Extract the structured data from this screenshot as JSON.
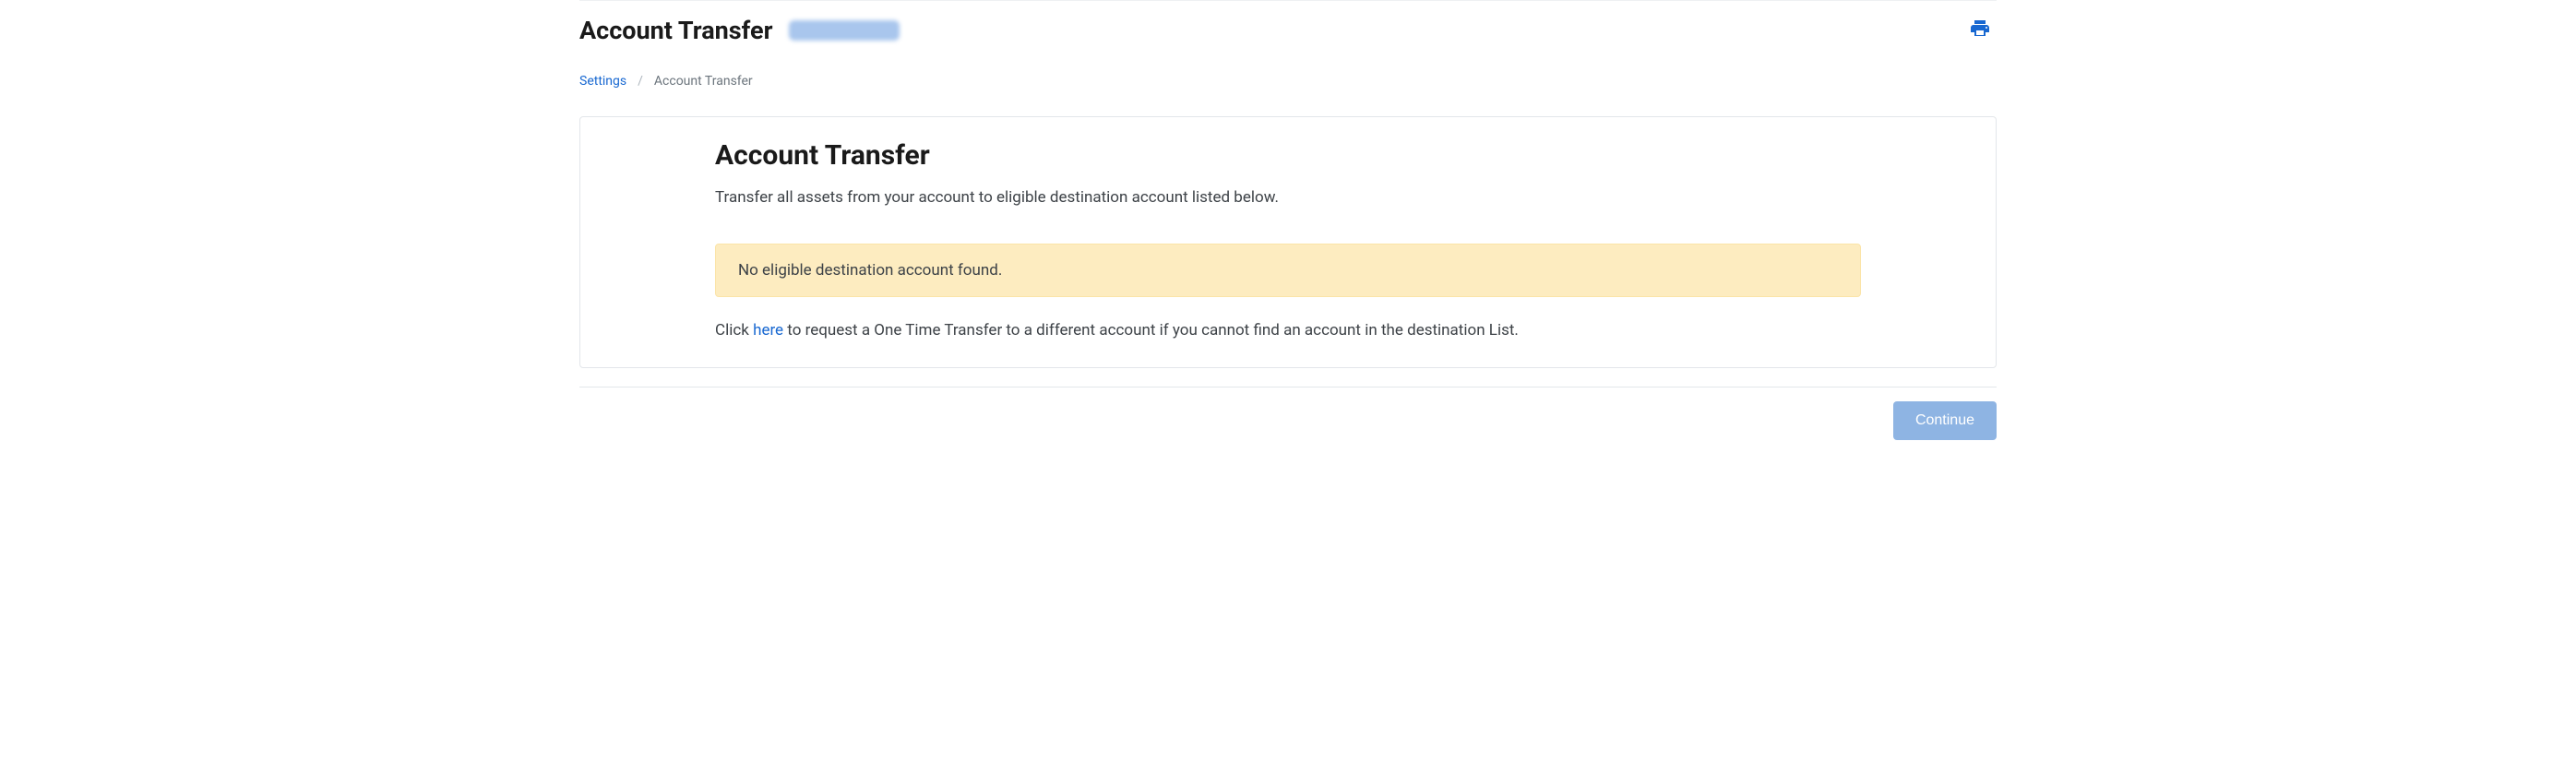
{
  "header": {
    "page_title": "Account Transfer"
  },
  "breadcrumb": {
    "settings_label": "Settings",
    "separator": "/",
    "current": "Account Transfer"
  },
  "card": {
    "title": "Account Transfer",
    "subtitle": "Transfer all assets from your account to eligible destination account listed below.",
    "alert_message": "No eligible destination account found.",
    "help_prefix": "Click ",
    "help_link": "here",
    "help_suffix": " to request a One Time Transfer to a different account if you cannot find an account in the destination List."
  },
  "footer": {
    "continue_label": "Continue"
  }
}
